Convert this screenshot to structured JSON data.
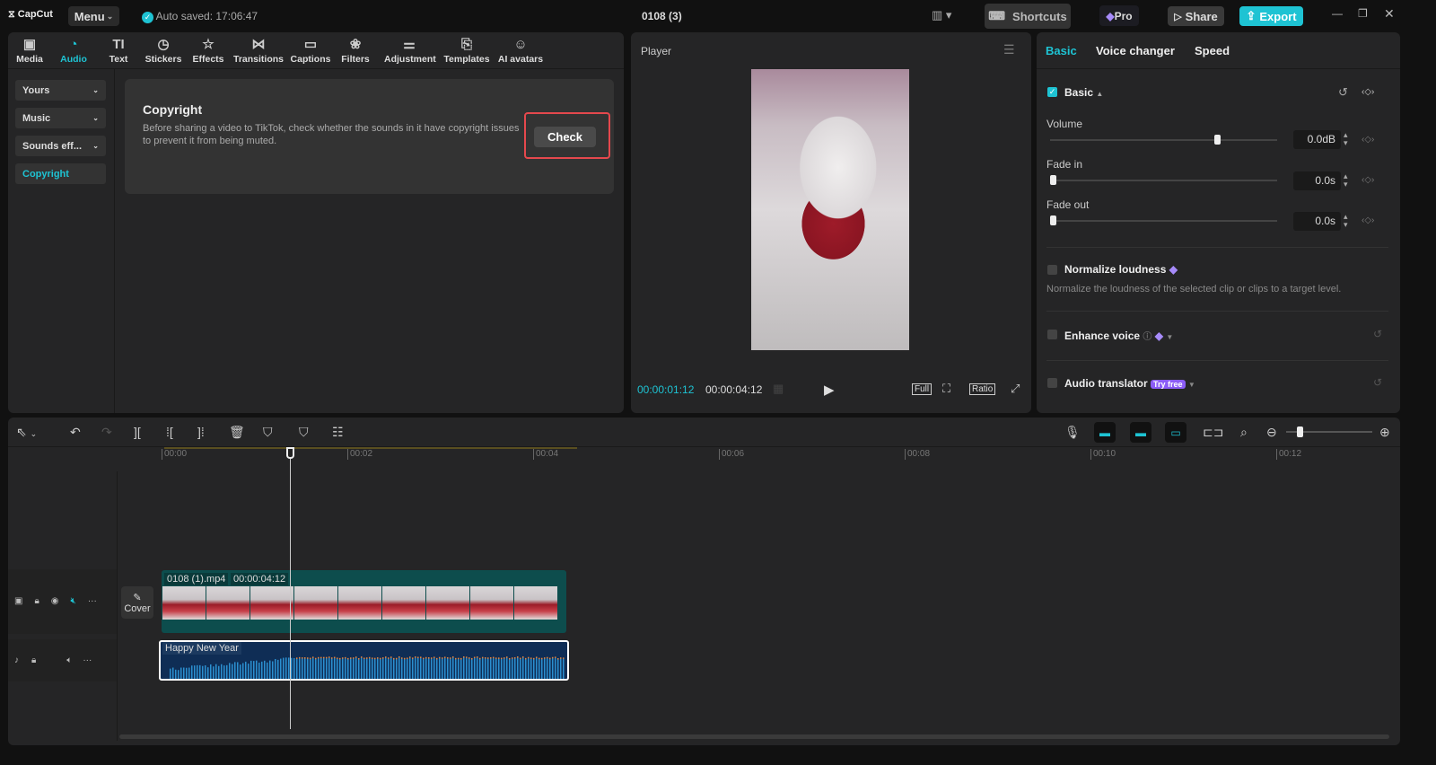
{
  "app": {
    "logo": "CapCut",
    "menu": "Menu",
    "autosave": "Auto saved: 17:06:47",
    "project_title": "0108 (3)",
    "shortcuts": "Shortcuts",
    "pro": "Pro",
    "share": "Share",
    "export": "Export",
    "accent": "#1ec3d3"
  },
  "toolbar": [
    {
      "label": "Media",
      "icon": "media-icon"
    },
    {
      "label": "Audio",
      "icon": "audio-icon",
      "active": true
    },
    {
      "label": "Text",
      "icon": "text-icon"
    },
    {
      "label": "Stickers",
      "icon": "stickers-icon"
    },
    {
      "label": "Effects",
      "icon": "effects-icon"
    },
    {
      "label": "Transitions",
      "icon": "transitions-icon"
    },
    {
      "label": "Captions",
      "icon": "captions-icon"
    },
    {
      "label": "Filters",
      "icon": "filters-icon"
    },
    {
      "label": "Adjustment",
      "icon": "adjustment-icon"
    },
    {
      "label": "Templates",
      "icon": "templates-icon"
    },
    {
      "label": "AI avatars",
      "icon": "ai-avatars-icon"
    }
  ],
  "sidebar": [
    {
      "label": "Yours"
    },
    {
      "label": "Music"
    },
    {
      "label": "Sounds eff..."
    },
    {
      "label": "Copyright",
      "active": true
    }
  ],
  "copyright": {
    "title": "Copyright",
    "desc": "Before sharing a video to TikTok, check whether the sounds in it have copyright issues to prevent it from being muted.",
    "check": "Check"
  },
  "player": {
    "title": "Player",
    "current": "00:00:01:12",
    "total": "00:00:04:12",
    "full": "Full",
    "ratio": "Ratio"
  },
  "props": {
    "tabs": [
      "Basic",
      "Voice changer",
      "Speed"
    ],
    "basic": "Basic",
    "volume_label": "Volume",
    "volume": "0.0dB",
    "volume_level": 0.75,
    "fadein_label": "Fade in",
    "fadein": "0.0s",
    "fadeout_label": "Fade out",
    "fadeout": "0.0s",
    "normalize": "Normalize loudness",
    "normalize_desc": "Normalize the loudness of the selected clip or clips to a target level.",
    "enhance": "Enhance voice",
    "translator": "Audio translator",
    "try_free": "Try free"
  },
  "timeline": {
    "ticks": [
      "00:00",
      "00:02",
      "00:04",
      "00:06",
      "00:08",
      "00:10",
      "00:12"
    ],
    "video_clip": "0108 (1).mp4",
    "video_duration": "00:00:04:12",
    "cover": "Cover",
    "audio_clip": "Happy New Year"
  }
}
